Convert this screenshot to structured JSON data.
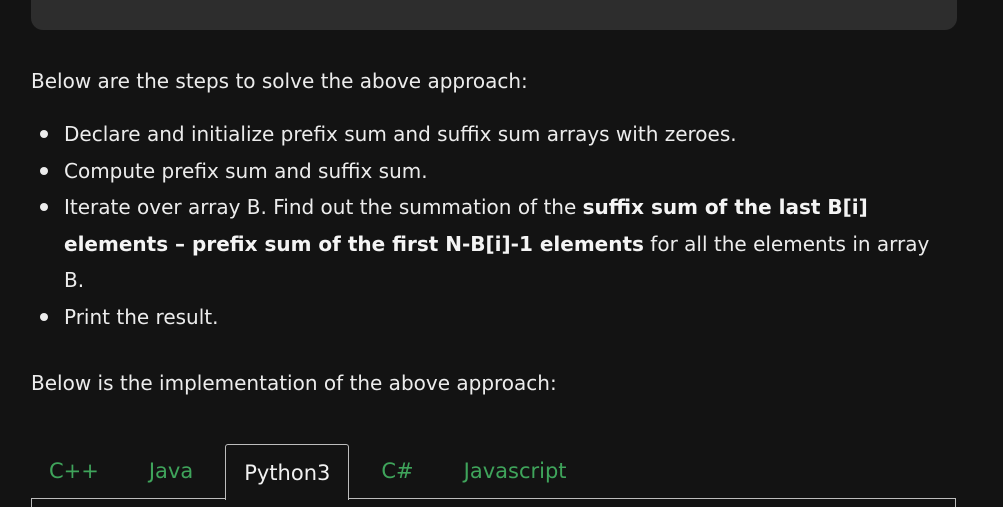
{
  "content": {
    "steps_intro": "Below are the steps to solve the above approach:",
    "steps": [
      {
        "text": "Declare and initialize prefix sum and suffix sum arrays with zeroes."
      },
      {
        "text": "Compute prefix sum and suffix sum."
      },
      {
        "part1": "Iterate over array B. Find out the summation of the ",
        "bold1": "suffix sum of the last B[i] elements",
        "part2": " – ",
        "bold2": "prefix sum of the first N-B[i]-1 elements",
        "part3": " for all the elements in array B."
      },
      {
        "text": "Print the result."
      }
    ],
    "impl_intro": "Below is the implementation of the above approach:"
  },
  "tabs": [
    {
      "label": "C++"
    },
    {
      "label": "Java"
    },
    {
      "label": "Python3",
      "active": true
    },
    {
      "label": "C#"
    },
    {
      "label": "Javascript"
    }
  ],
  "colors": {
    "background": "#131313",
    "code_panel": "#2d2d2d",
    "tab_link": "#3fa45b",
    "text": "#ececec"
  }
}
